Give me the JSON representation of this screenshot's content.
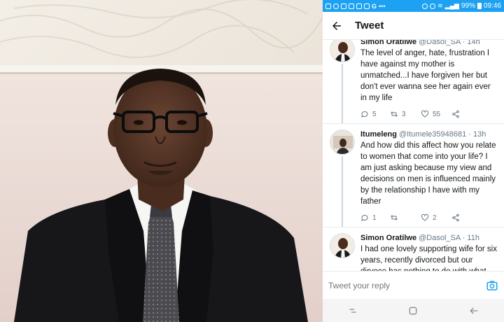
{
  "status_bar": {
    "battery": "99%",
    "time": "09:46",
    "bg_color": "#1da1f2",
    "icons": [
      "facebook-icon",
      "messenger-icon",
      "twitter-icon",
      "message-icon",
      "gallery-icon",
      "mail-icon",
      "google-icon",
      "dots-icon",
      "key-icon",
      "alarm-icon",
      "wifi-icon",
      "lte-icon",
      "signal-icon"
    ]
  },
  "header": {
    "back_icon": "back-arrow-icon",
    "title": "Tweet"
  },
  "tweets": [
    {
      "name": "Simon Oratilwe",
      "handle": "@Dasol_SA",
      "time": "· 14h",
      "text": "The level of anger, hate, frustration I have against my mother is unmatched...I have forgiven her but don't ever wanna see her again ever in my life",
      "replies": "5",
      "retweets": "3",
      "likes": "55"
    },
    {
      "name": "Itumeleng",
      "handle": "@Itumele35948681",
      "time": "· 13h",
      "text": "And how did this affect how you relate to women that come into your life? I am just asking because my view and decisions on men is influenced mainly by the relationship I have with my father",
      "replies": "1",
      "retweets": "",
      "likes": "2"
    },
    {
      "name": "Simon Oratilwe",
      "handle": "@Dasol_SA",
      "time": "· 11h",
      "text": "I had one lovely supporting wife for six years, recently divorced but our dirvoce has nothing to do with what mentioned above...we separated because we grew apart. One thing about me is I will always give love, care n support because I know how it is to b abandoned"
    }
  ],
  "reply_bar": {
    "placeholder": "Tweet your reply",
    "camera_icon": "camera-icon"
  },
  "nav_bar": {
    "icons": [
      "recent-apps-icon",
      "home-icon",
      "back-icon"
    ]
  },
  "colors": {
    "accent": "#1da1f2",
    "text_primary": "#14171a",
    "text_secondary": "#657786"
  }
}
